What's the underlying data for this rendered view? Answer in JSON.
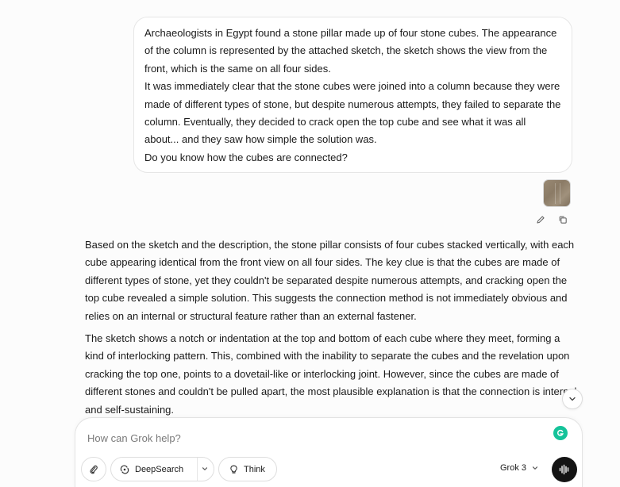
{
  "user_message": {
    "paragraphs": [
      "Archaeologists in Egypt found a stone pillar made up of four stone cubes. The appearance of the column is represented by the attached sketch, the sketch shows the view from the front, which is the same on all four sides.",
      "It was immediately clear that the stone cubes were joined into a column because they were made of different types of stone, but despite numerous attempts, they failed to separate the column. Eventually, they decided to crack open the top cube and see what it was all about... and they saw how simple the solution was.",
      "Do you know how the cubes are connected?"
    ],
    "actions": {
      "edit_icon": "pencil-icon",
      "copy_icon": "copy-icon"
    }
  },
  "assistant_message": {
    "paragraphs": [
      "Based on the sketch and the description, the stone pillar consists of four cubes stacked vertically, with each cube appearing identical from the front view on all four sides. The key clue is that the cubes are made of different types of stone, yet they couldn't be separated despite numerous attempts, and cracking open the top cube revealed a simple solution. This suggests the connection method is not immediately obvious and relies on an internal or structural feature rather than an external fastener.",
      "The sketch shows a notch or indentation at the top and bottom of each cube where they meet, forming a kind of interlocking pattern. This, combined with the inability to separate the cubes and the revelation upon cracking the top one, points to a dovetail-like or interlocking joint. However, since the cubes are made of different stones and couldn't be pulled apart, the most plausible explanation is that the connection is internal and self-sustaining."
    ]
  },
  "composer": {
    "placeholder": "How can Grok help?",
    "deepsearch_label": "DeepSearch",
    "think_label": "Think",
    "model_label": "Grok 3"
  },
  "colors": {
    "background": "#fcfcfc",
    "bubble": "#ffffff",
    "voice_button": "#141414",
    "grammarly": "#15c39a"
  }
}
